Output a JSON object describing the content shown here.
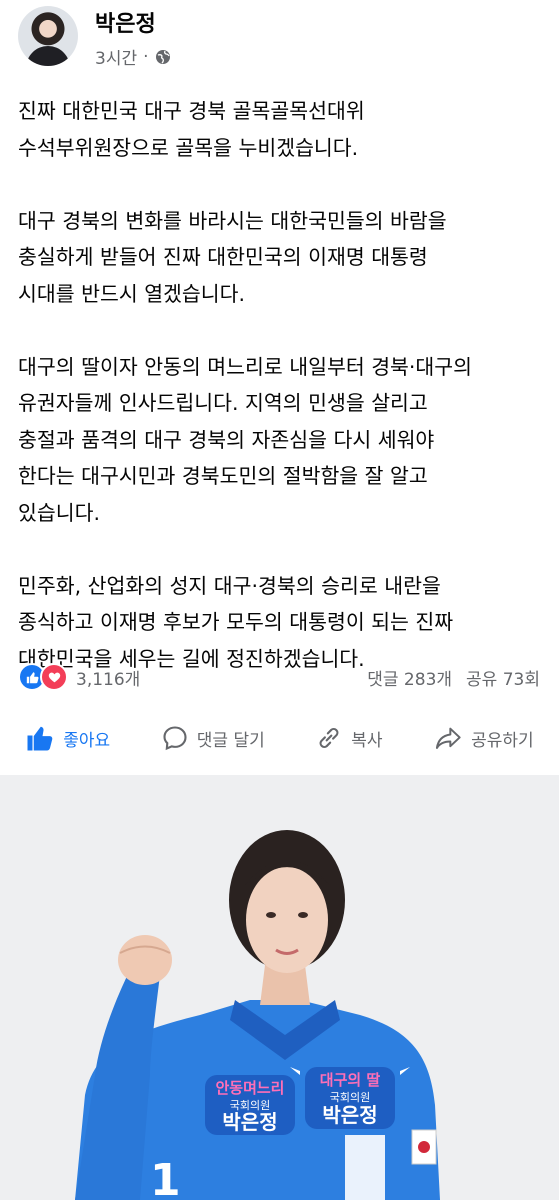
{
  "post": {
    "author": "박은정",
    "time": "3시간",
    "separator": "·",
    "paragraphs": [
      "진짜 대한민국 대구 경북 골목골목선대위\n수석부위원장으로 골목을 누비겠습니다.",
      "대구 경북의 변화를 바라시는 대한국민들의 바람을\n충실하게 받들어 진짜 대한민국의 이재명 대통령\n시대를 반드시 열겠습니다.",
      "대구의 딸이자 안동의 며느리로 내일부터 경북·대구의\n유권자들께 인사드립니다. 지역의 민생을 살리고\n충절과 품격의 대구 경북의 자존심을 다시 세워야\n한다는 대구시민과 경북도민의 절박함을 잘 알고\n있습니다.",
      "민주화, 산업화의 성지 대구·경북의 승리로 내란을\n종식하고 이재명 후보가 모두의 대통령이 되는 진짜\n대한민국을 세우는 길에 정진하겠습니다."
    ]
  },
  "stats": {
    "reactions": "3,116개",
    "comments": "댓글 283개",
    "shares": "공유 73회"
  },
  "actions": {
    "like": "좋아요",
    "comment": "댓글 달기",
    "copy": "복사",
    "share": "공유하기"
  },
  "photo_sign": {
    "left_line1": "안동며느리",
    "left_line2": "국회의원",
    "left_line3": "박은정",
    "right_line1": "대구의 딸",
    "right_line2": "국회의원",
    "right_line3": "박은정",
    "jacket_text": "1"
  },
  "colors": {
    "accent": "#1877f2",
    "love": "#f33e58",
    "secondary_text": "#65676b",
    "jacket_blue": "#2d7fe0"
  }
}
